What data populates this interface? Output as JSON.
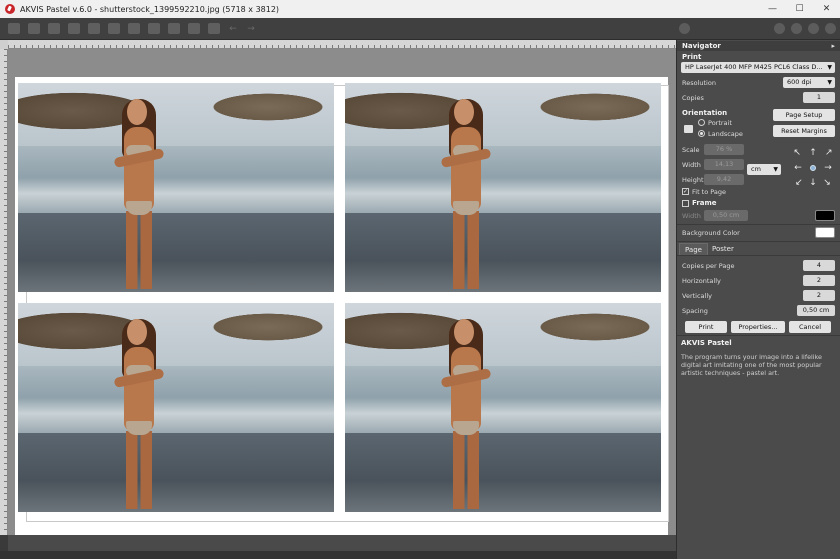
{
  "window": {
    "title": "AKVIS Pastel v.6.0 - shutterstock_1399592210.jpg (5718 x 3812)"
  },
  "panel": {
    "navigator_header": "Navigator",
    "print_header": "Print",
    "printer": "HP LaserJet 400 MFP M425 PCL6 Class D...",
    "resolution_label": "Resolution",
    "resolution_value": "600 dpi",
    "copies_label": "Copies",
    "copies_value": "1",
    "orientation_label": "Orientation",
    "portrait_label": "Portrait",
    "landscape_label": "Landscape",
    "orientation_selected": "Landscape",
    "page_setup_button": "Page Setup",
    "reset_margins_button": "Reset Margins",
    "scale_label": "Scale",
    "scale_value": "76 %",
    "width_label": "Width",
    "width_value": "14,13",
    "height_label": "Height",
    "height_value": "9,42",
    "unit_value": "cm",
    "fit_to_page_label": "Fit to Page",
    "fit_to_page_checked": true,
    "frame_label": "Frame",
    "frame_checked": false,
    "frame_width_label": "Width",
    "frame_width_value": "0,50 cm",
    "frame_color": "#000000",
    "background_color_label": "Background Color",
    "background_color": "#ffffff",
    "tabs": [
      "Page",
      "Poster"
    ],
    "active_tab": "Page",
    "copies_per_page_label": "Copies per Page",
    "copies_per_page_value": "4",
    "horizontally_label": "Horizontally",
    "horizontally_value": "2",
    "vertically_label": "Vertically",
    "vertically_value": "2",
    "spacing_label": "Spacing",
    "spacing_value": "0,50 cm",
    "print_button": "Print",
    "properties_button": "Properties...",
    "cancel_button": "Cancel",
    "info_header": "AKVIS Pastel",
    "info_text": "The program turns your image into a lifelike digital art imitating one of the most popular artistic techniques - pastel art."
  }
}
